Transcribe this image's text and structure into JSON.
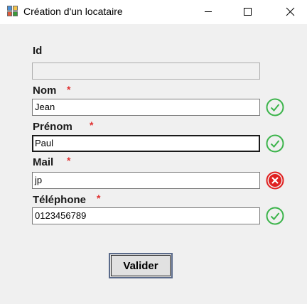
{
  "window": {
    "title": "Création d'un locataire",
    "controls": {
      "minimize_icon": "minimize-icon",
      "maximize_icon": "maximize-icon",
      "close_icon": "close-icon"
    }
  },
  "form": {
    "id": {
      "label": "Id",
      "value": "",
      "required": false,
      "enabled": false
    },
    "nom": {
      "label": "Nom",
      "required_mark": "*",
      "value": "Jean",
      "status": "valid"
    },
    "prenom": {
      "label": "Prénom",
      "required_mark": "*",
      "value": "Paul",
      "status": "valid",
      "focused": true
    },
    "mail": {
      "label": "Mail",
      "required_mark": "*",
      "value": "jp",
      "status": "invalid"
    },
    "telephone": {
      "label": "Téléphone",
      "required_mark": "*",
      "value": "0123456789",
      "status": "valid"
    }
  },
  "actions": {
    "validate_label": "Valider"
  },
  "colors": {
    "valid": "#3cb44b",
    "invalid": "#e02020",
    "required": "#e03030"
  }
}
